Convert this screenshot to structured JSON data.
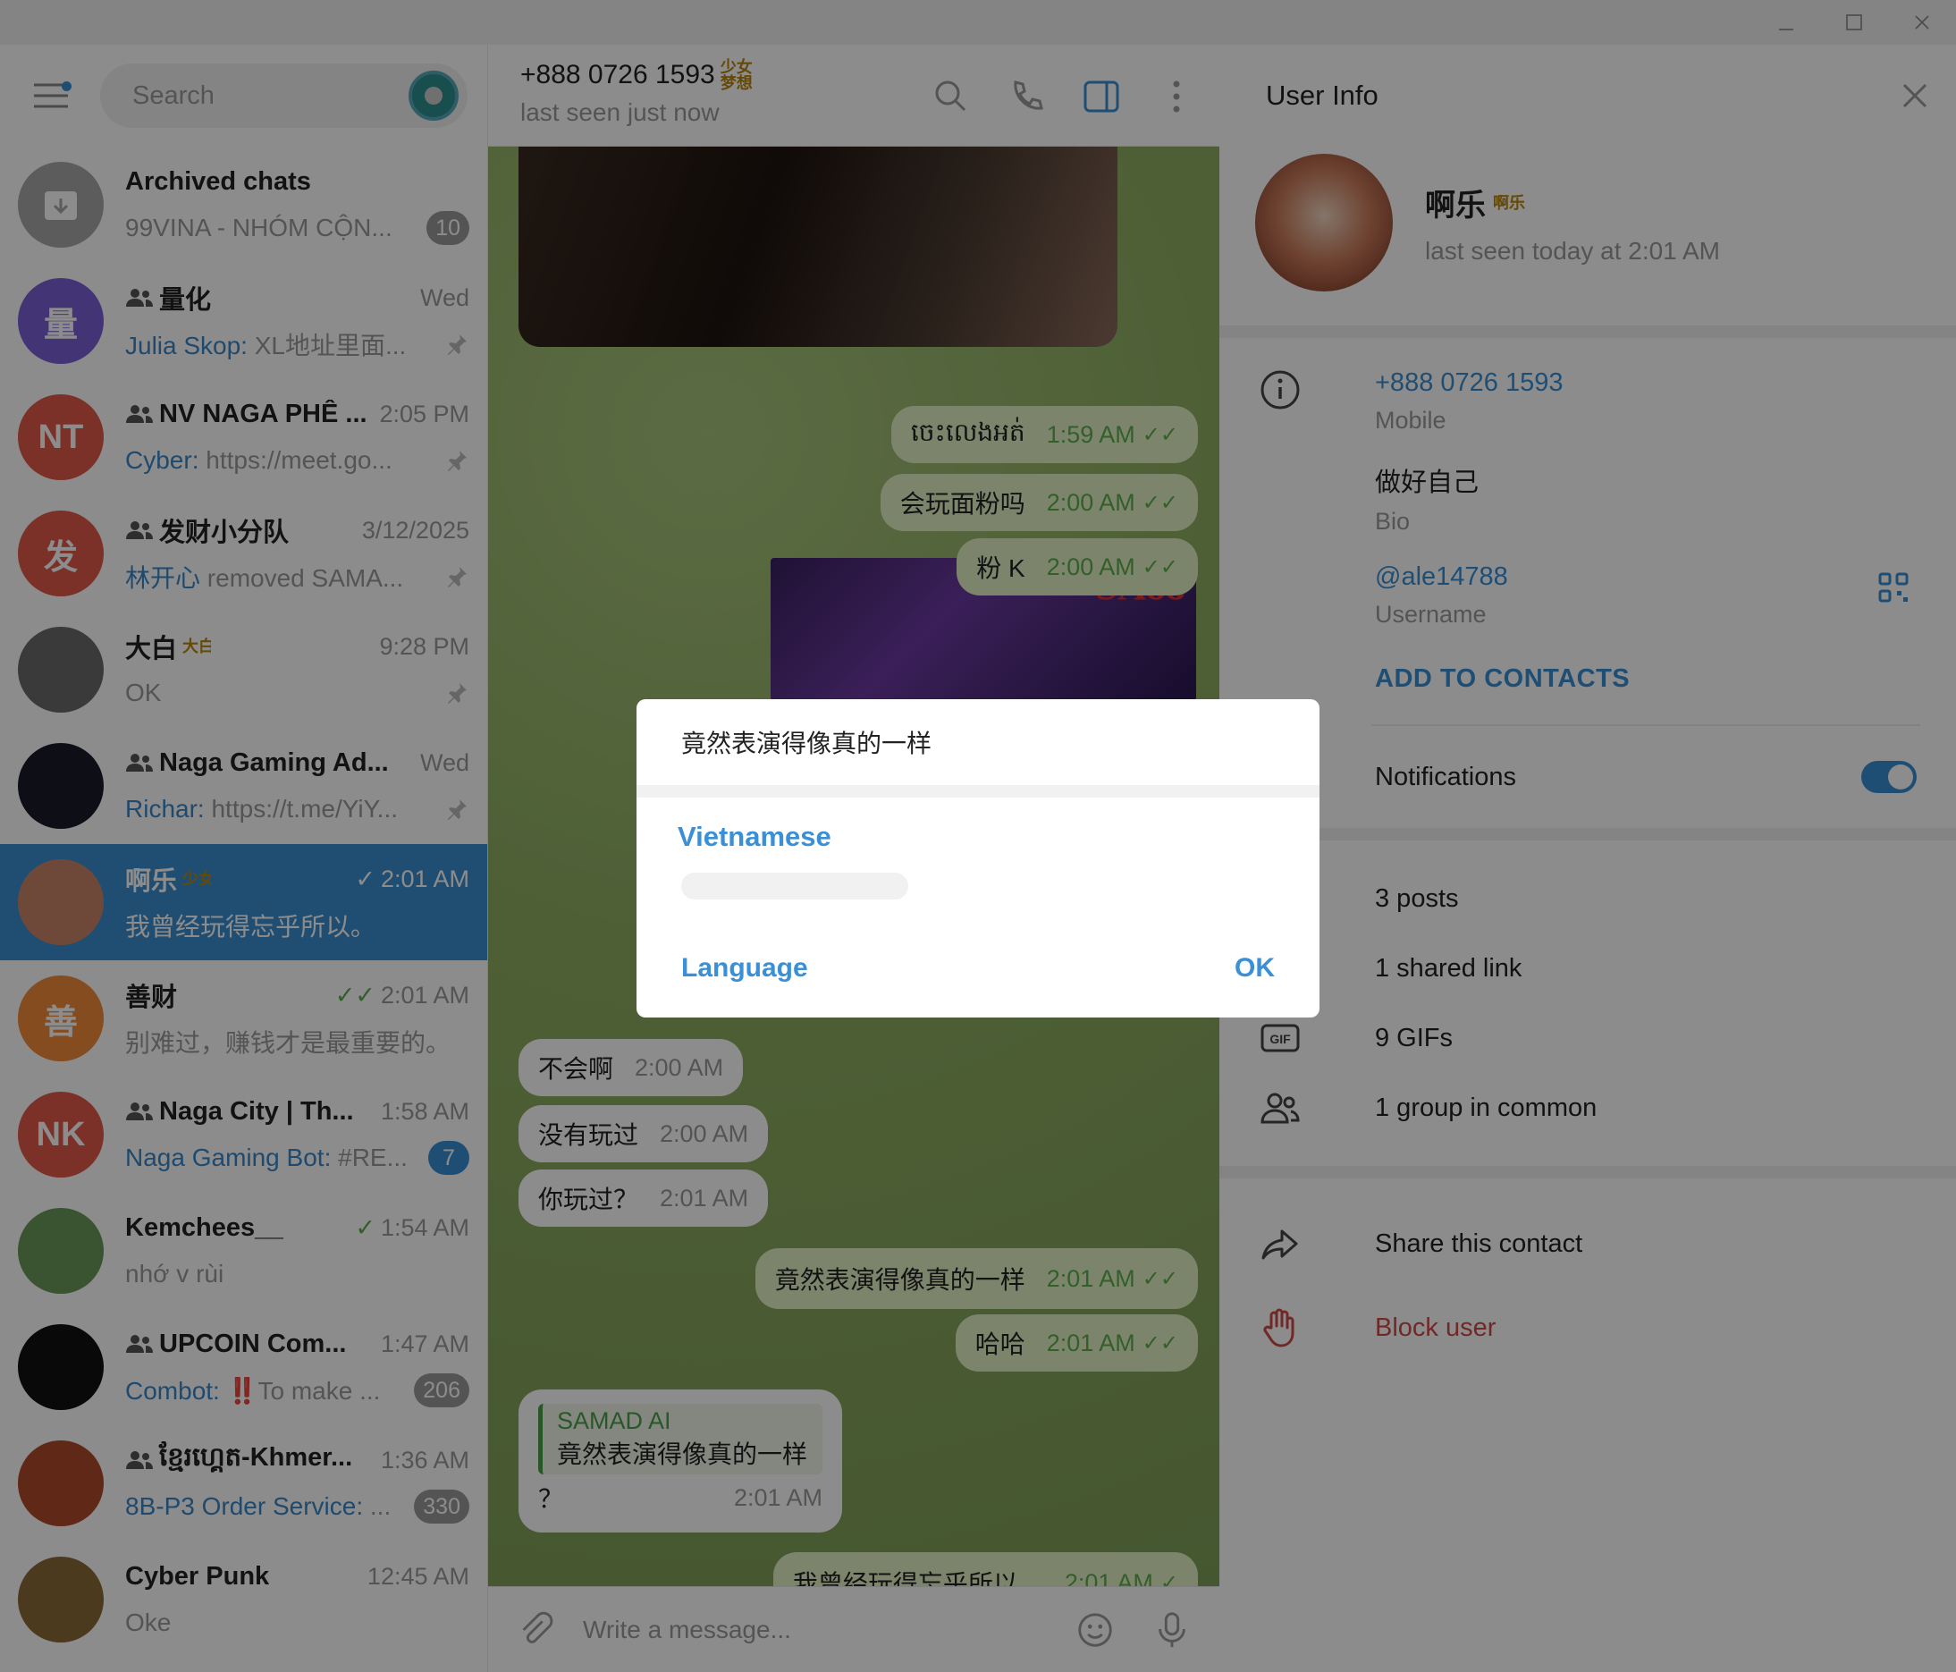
{
  "window": {
    "controls": [
      "minimize-icon",
      "maximize-icon",
      "close-icon"
    ]
  },
  "search": {
    "placeholder": "Search"
  },
  "chats": [
    {
      "name": "Archived chats",
      "preview": "99VINA - NHÓM CỘN...",
      "time": "",
      "badge": "10",
      "avatar": "archive-icon",
      "avcolor": "#a8a8a8",
      "group": false
    },
    {
      "name": "量化",
      "preview_sender": "Julia Skop:",
      "preview": "XL地址里面...",
      "time": "Wed",
      "pinned": true,
      "avatar_text": "量",
      "avcolor": "#7b5fd6",
      "group": true
    },
    {
      "name": "NV NAGA PHÊ ...",
      "preview_sender": "Cyber:",
      "preview": "https://meet.go...",
      "time": "2:05 PM",
      "pinned": true,
      "avatar_text": "NT",
      "avcolor": "#e05a4a",
      "group": true
    },
    {
      "name": "发财小分队",
      "preview_sender": "林开心",
      "preview": "removed SAMA...",
      "time": "3/12/2025",
      "pinned": true,
      "avatar_text": "发",
      "avcolor": "#e05a4a",
      "group": true
    },
    {
      "name": "大白",
      "emoji": "大白",
      "preview": "OK",
      "time": "9:28 PM",
      "pinned": true,
      "avcolor": "#6a6a6a",
      "group": false
    },
    {
      "name": "Naga Gaming Ad...",
      "preview_sender": "Richar:",
      "preview": "https://t.me/YiY...",
      "time": "Wed",
      "pinned": true,
      "avcolor": "#1a1a2a",
      "group": true
    },
    {
      "name": "啊乐",
      "emoji": "少女梦想",
      "preview": "我曾经玩得忘乎所以。",
      "time": "2:01 AM",
      "active": true,
      "avcolor": "#c9856a",
      "group": false
    },
    {
      "name": "善财",
      "preview": "别难过，赚钱才是最重要的。",
      "time": "2:01 AM",
      "avatar_text": "善",
      "avcolor": "#f08a3a",
      "group": false
    },
    {
      "name": "Naga City | Th...",
      "preview_sender": "Naga Gaming Bot:",
      "preview": "#RE...",
      "time": "1:58 AM",
      "badge": "7",
      "avatar_text": "NK",
      "avcolor": "#e05a4a",
      "group": true
    },
    {
      "name": "Kemchees__",
      "preview": "nhớ v rùi",
      "time": "1:54 AM",
      "avcolor": "#6a9a5a",
      "group": false
    },
    {
      "name": "UPCOIN Com...",
      "preview_sender": "Combot:",
      "preview": "‼️To make ...",
      "time": "1:47 AM",
      "badge": "206",
      "avcolor": "#111",
      "group": true
    },
    {
      "name": "ខ្មែរហ្គេត-Khmer...",
      "preview_sender": "8B-P3 Order Service:",
      "preview": "...",
      "time": "1:36 AM",
      "badge": "330",
      "avcolor": "#b04a2a",
      "group": true
    },
    {
      "name": "Cyber Punk",
      "preview": "Oke",
      "time": "12:45 AM",
      "avcolor": "#8a6a3a",
      "group": false
    }
  ],
  "chat_header": {
    "title": "+888 0726 1593",
    "emoji": "少女梦想",
    "status": "last seen just now"
  },
  "messages": [
    {
      "text": "ចេះលេងអត់",
      "time": "1:59 AM",
      "dir": "out"
    },
    {
      "text": "会玩面粉吗",
      "time": "2:00 AM",
      "dir": "out"
    },
    {
      "text": "粉 K",
      "time": "2:00 AM",
      "dir": "out"
    },
    {
      "text": "不会啊",
      "time": "2:00 AM",
      "dir": "in"
    },
    {
      "text": "没有玩过",
      "time": "2:00 AM",
      "dir": "in"
    },
    {
      "text": "你玩过？",
      "time": "2:01 AM",
      "dir": "in"
    },
    {
      "text": "竟然表演得像真的一样",
      "time": "2:01 AM",
      "dir": "out"
    },
    {
      "text": "哈哈",
      "time": "2:01 AM",
      "dir": "out"
    },
    {
      "reply_name": "SAMAD AI",
      "reply_text": "竟然表演得像真的一样",
      "text": "？",
      "time": "2:01 AM",
      "dir": "in"
    },
    {
      "text": "我曾经玩得忘乎所以。",
      "time": "2:01 AM",
      "dir": "out"
    }
  ],
  "media_watermark": "SA88",
  "compose": {
    "placeholder": "Write a message..."
  },
  "user_info": {
    "title": "User Info",
    "name": "啊乐",
    "emoji": "啊乐",
    "last_seen": "last seen today at 2:01 AM",
    "phone": "+888 0726 1593",
    "phone_label": "Mobile",
    "bio": "做好自己",
    "bio_label": "Bio",
    "username": "@ale14788",
    "username_label": "Username",
    "add_contacts": "ADD TO CONTACTS",
    "notifications": "Notifications",
    "notifications_on": true,
    "posts": "3 posts",
    "links": "1 shared link",
    "gifs": "9 GIFs",
    "groups": "1 group in common",
    "share": "Share this contact",
    "block": "Block user",
    "block_color": "#d14a4a",
    "accent": "#3a8fd6"
  },
  "dialog": {
    "text": "竟然表演得像真的一样",
    "language_title": "Vietnamese",
    "language_button": "Language",
    "ok_button": "OK"
  }
}
